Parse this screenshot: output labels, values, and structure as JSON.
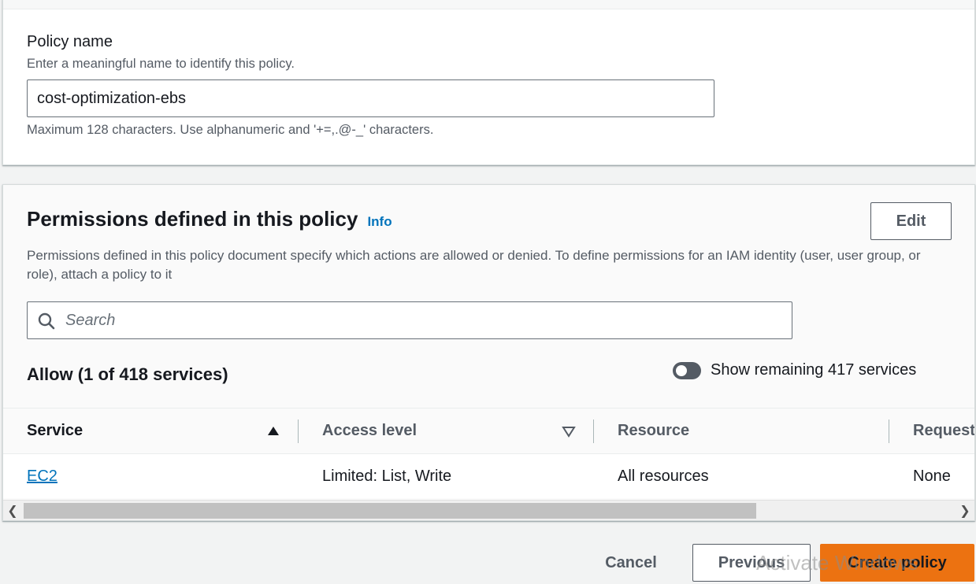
{
  "policy_name": {
    "label": "Policy name",
    "description": "Enter a meaningful name to identify this policy.",
    "value": "cost-optimization-ebs",
    "constraint": "Maximum 128 characters. Use alphanumeric and '+=,.@-_' characters."
  },
  "permissions": {
    "title": "Permissions defined in this policy",
    "info_label": "Info",
    "edit_label": "Edit",
    "description": "Permissions defined in this policy document specify which actions are allowed or denied. To define permissions for an IAM identity (user, user group, or role), attach a policy to it",
    "search_placeholder": "Search",
    "allow_heading": "Allow (1 of 418 services)",
    "toggle_label": "Show remaining 417 services",
    "toggle_on": false,
    "table": {
      "columns": [
        "Service",
        "Access level",
        "Resource",
        "Request"
      ],
      "rows": [
        {
          "service": "EC2",
          "access_level": "Limited: List, Write",
          "resource": "All resources",
          "request": "None"
        }
      ]
    }
  },
  "footer": {
    "cancel_label": "Cancel",
    "previous_label": "Previous",
    "create_label": "Create policy",
    "watermark": "Activate Windows"
  },
  "colors": {
    "link": "#0073bb",
    "primary_button": "#ec7211",
    "toggle_off": "#545b64"
  },
  "icons": {
    "search": "search-icon",
    "sort_ascending": "sort-ascending-icon",
    "sort_descending": "sort-descending-icon",
    "scroll_left": "chevron-left-icon",
    "scroll_right": "chevron-right-icon"
  }
}
